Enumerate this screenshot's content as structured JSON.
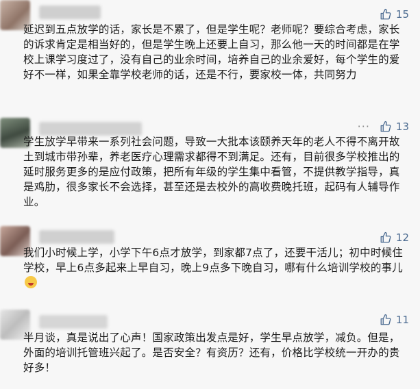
{
  "comments": [
    {
      "likes": "15",
      "text": "延迟到五点放学的话，家长是不累了，但是学生呢？老师呢？要综合考虑，家长的诉求肯定是相当好的，但是学生晚上还要上自习，那么他一天的时间都是在学校上课学习度过了，没有自己的业余时间，培养自己的业余爱好，每个学生的爱好不一样，如果全靠学校老师的话，还是不行，要家校一体，共同努力"
    },
    {
      "likes": "13",
      "text": "学生放学早带来一系列社会问题，导致一大批本该颐养天年的老人不得不离开故土到城市带孙辈，养老医疗心理需求都得不到满足。还有，目前很多学校推出的延时服务更多的是应付政策，把所有年级的学生集中看管，不提供教学指导，真是鸡肋，很多家长不会选择，甚至还是去校外的高收费晚托班，起码有人辅导作业。"
    },
    {
      "likes": "12",
      "text": "我们小时候上学，小学下午6点才放学，到家都7点了，还要干活儿；初中时候住学校，早上6点多起来上早自习，晚上9点多下晚自习，哪有什么培训学校的事儿"
    },
    {
      "likes": "11",
      "text": "半月谈，真是说出了心声！国家政策出发点是好，学生早点放学，减负。但是，外面的培训托管班兴起了。是否安全？有资历？还有，价格比学校统一开办的贵好多！"
    }
  ],
  "icons": {
    "like": "thumbs-up-icon",
    "more": "more-dots-icon",
    "emoji": "crying-laughing-emoji-icon"
  },
  "colors": {
    "background": "#f7f7f7",
    "like_count": "#4a6a90",
    "text": "#1c1c1c"
  }
}
